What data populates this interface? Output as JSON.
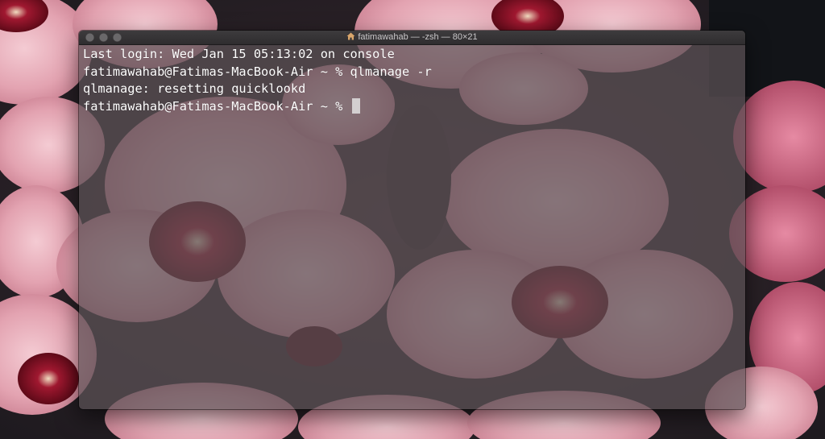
{
  "window": {
    "title": "fatimawahab — -zsh — 80×21",
    "title_icon": "home-icon"
  },
  "terminal": {
    "lines": [
      "Last login: Wed Jan 15 05:13:02 on console",
      "fatimawahab@Fatimas-MacBook-Air ~ % qlmanage -r",
      "qlmanage: resetting quicklookd",
      "fatimawahab@Fatimas-MacBook-Air ~ % "
    ]
  },
  "colors": {
    "terminal_text": "#ffffff",
    "titlebar": "#353335",
    "traffic_light_inactive": "#6a686a",
    "cursor": "#e1e1e1"
  },
  "wallpaper": {
    "description_icon": "pink-wax-flower-wallpaper"
  }
}
